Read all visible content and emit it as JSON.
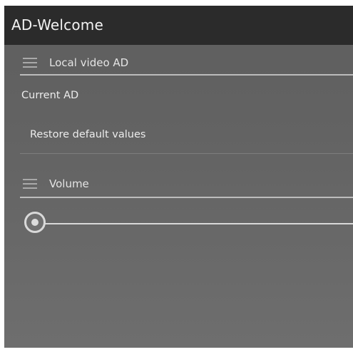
{
  "titlebar": {
    "title": "AD-Welcome"
  },
  "sections": {
    "local_video": {
      "label": "Local video AD"
    },
    "volume": {
      "label": "Volume"
    }
  },
  "rows": {
    "current_ad": "Current AD",
    "restore_defaults": "Restore default values"
  },
  "volume_slider": {
    "value_fraction": 0.0
  },
  "colors": {
    "titlebar": "#2b2b2b",
    "background": "#646464",
    "divider": "#bdbdbd",
    "text": "#ececec"
  }
}
